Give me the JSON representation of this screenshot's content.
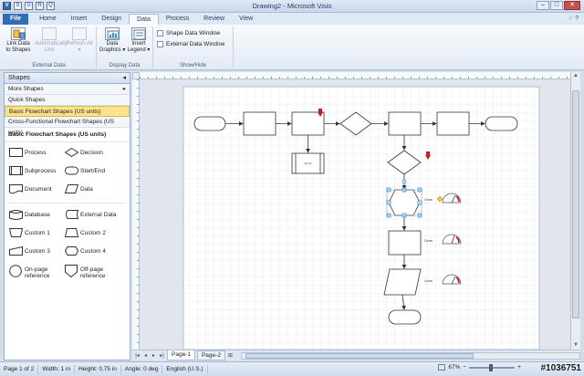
{
  "window": {
    "title": "Drawing2 - Microsoft Visio"
  },
  "quick_access": {
    "items": [
      "V",
      "S",
      "U",
      "R",
      "Q"
    ]
  },
  "window_controls": {
    "minimize": "–",
    "maximize": "□",
    "close": "✕"
  },
  "tabs": [
    {
      "label": "File"
    },
    {
      "label": "Home"
    },
    {
      "label": "Insert"
    },
    {
      "label": "Design"
    },
    {
      "label": "Data"
    },
    {
      "label": "Process"
    },
    {
      "label": "Review"
    },
    {
      "label": "View"
    }
  ],
  "help_glyphs": "♢ ?",
  "ribbon": {
    "groups": {
      "external_data": "External Data",
      "display_data": "Display Data",
      "show_hide": "Show/Hide"
    },
    "link_data": "Link Data to Shapes",
    "auto_link": "Automatically Link",
    "refresh_all": "Refresh All ▾",
    "data_graphics": "Data Graphics ▾",
    "insert_legend": "Insert Legend ▾",
    "shape_data_window": "Shape Data Window",
    "external_data_window": "External Data Window"
  },
  "shapes_panel": {
    "title": "Shapes",
    "more_shapes": "More Shapes",
    "quick_shapes": "Quick Shapes",
    "basic_flowchart": "Basic Flowchart Shapes (US units)",
    "cross_functional": "Cross-Functional Flowchart Shapes (US units)",
    "stencil_title": "Basic Flowchart Shapes (US units)",
    "items": [
      "Process",
      "Decision",
      "Subprocess",
      "Start/End",
      "Document",
      "Data",
      "Database",
      "External Data",
      "Custom 1",
      "Custom 2",
      "Custom 3",
      "Custom 4",
      "On-page reference",
      "Off-page reference"
    ]
  },
  "diagram": {
    "box_label": "ACCT",
    "side_label": "Owner"
  },
  "pages": {
    "tab1": "Page-1",
    "tab2": "Page-2"
  },
  "status": {
    "page": "Page 1 of 2",
    "width": "Width: 1 in",
    "height": "Height: 0.75 in",
    "angle": "Angle: 0 deg",
    "language": "English (U.S.)",
    "zoom": "67%"
  },
  "watermark": "#1036751",
  "colors": {
    "accent": "#2f6db5",
    "selected": "#fbe38e",
    "selection_handle": "#3d8fd6",
    "flag": "#c21f1f"
  }
}
